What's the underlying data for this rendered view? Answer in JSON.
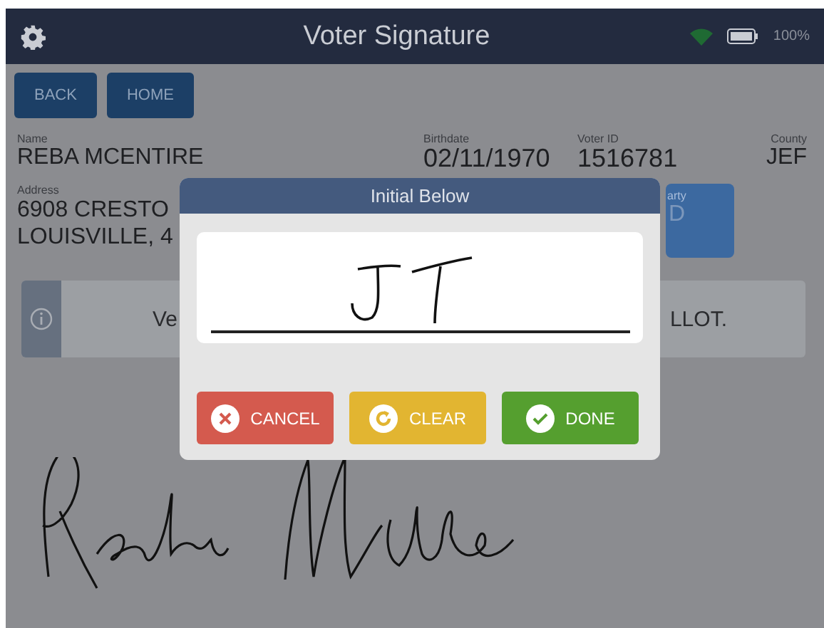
{
  "header": {
    "title": "Voter Signature",
    "battery": "100%"
  },
  "nav_buttons": [
    {
      "label": "BACK"
    },
    {
      "label": "HOME"
    }
  ],
  "voter": {
    "name_label": "Name",
    "name": "REBA MCENTIRE",
    "birthdate_label": "Birthdate",
    "birthdate": "02/11/1970",
    "voter_id_label": "Voter ID",
    "voter_id": "1516781",
    "county_label": "County",
    "county": "JEF",
    "address_label": "Address",
    "address_lines": [
      "6908 CRESTO",
      "LOUISVILLE, 4"
    ],
    "party_label": "arty",
    "party": "D"
  },
  "banner": {
    "text_left": "Ve",
    "text_right": "LLOT."
  },
  "dialog": {
    "title": "Initial Below",
    "buttons": [
      {
        "kind": "cancel",
        "label": "CANCEL"
      },
      {
        "kind": "clear",
        "label": "CLEAR"
      },
      {
        "kind": "done",
        "label": "DONE"
      }
    ]
  }
}
